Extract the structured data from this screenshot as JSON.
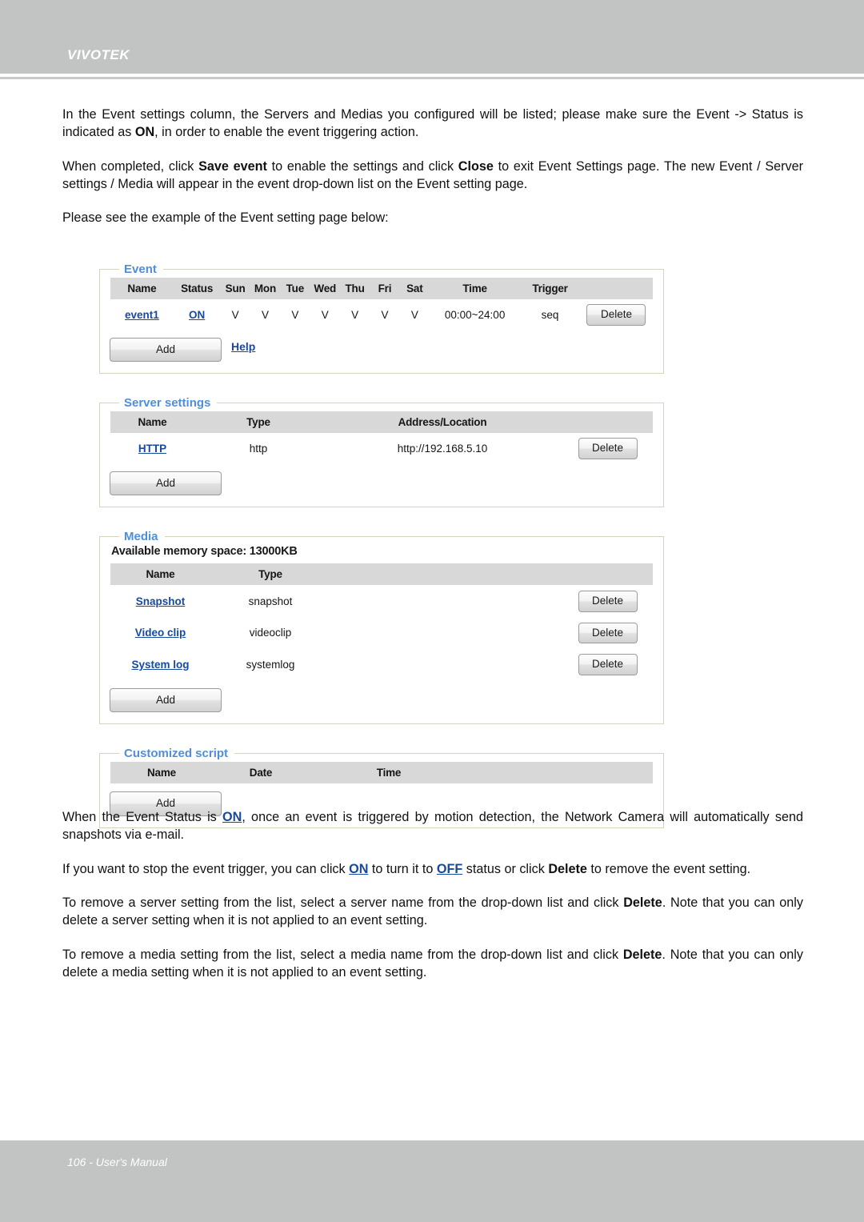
{
  "header": {
    "brand": "VIVOTEK"
  },
  "body_paragraphs": {
    "p1_a": "In the Event settings column, the Servers and Medias you configured will be listed; please make sure the Event -> Status is indicated as ",
    "p1_on": "ON",
    "p1_b": ", in order to enable the event triggering action.",
    "p2_a": "When completed, click ",
    "p2_save": "Save event",
    "p2_b": " to enable the settings and click ",
    "p2_close": "Close",
    "p2_c": " to exit Event Settings page. The new Event / Server settings / Media will appear in the event drop-down list on the Event setting page.",
    "p3": "Please see the example of the Event setting page below:",
    "p4_a": "When the Event Status is ",
    "p4_on": "ON",
    "p4_b": ", once an event is triggered by motion detection, the Network Camera will automatically send snapshots via e-mail.",
    "p5_a": "If you want to stop the event trigger, you can click ",
    "p5_on": "ON",
    "p5_b": " to turn it to ",
    "p5_off": "OFF",
    "p5_c": " status or click ",
    "p5_delete": "Delete",
    "p5_d": " to remove the event setting.",
    "p6_a": "To remove a server setting from the list, select a server name from the drop-down list and click ",
    "p6_delete": "Delete",
    "p6_b": ". Note that you can only delete a server setting when it is not applied to an event setting.",
    "p7_a": "To remove a media setting from the list, select a media name from the drop-down list and click ",
    "p7_delete": "Delete",
    "p7_b": ". Note that you can only delete a media setting when it is not applied to an event setting."
  },
  "event_panel": {
    "legend": "Event",
    "columns": [
      "Name",
      "Status",
      "Sun",
      "Mon",
      "Tue",
      "Wed",
      "Thu",
      "Fri",
      "Sat",
      "Time",
      "Trigger",
      ""
    ],
    "rows": [
      {
        "name": "event1",
        "status": "ON",
        "sun": "V",
        "mon": "V",
        "tue": "V",
        "wed": "V",
        "thu": "V",
        "fri": "V",
        "sat": "V",
        "time": "00:00~24:00",
        "trigger": "seq",
        "delete_label": "Delete"
      }
    ],
    "add_label": "Add",
    "help_label": "Help"
  },
  "server_panel": {
    "legend": "Server settings",
    "columns": [
      "Name",
      "Type",
      "Address/Location",
      ""
    ],
    "rows": [
      {
        "name": "HTTP",
        "type": "http",
        "address": "http://192.168.5.10",
        "delete_label": "Delete"
      }
    ],
    "add_label": "Add"
  },
  "media_panel": {
    "legend": "Media",
    "memory_line": "Available memory space: 13000KB",
    "columns": [
      "Name",
      "Type",
      "",
      ""
    ],
    "rows": [
      {
        "name": "Snapshot",
        "type": "snapshot",
        "delete_label": "Delete"
      },
      {
        "name": "Video clip",
        "type": "videoclip",
        "delete_label": "Delete"
      },
      {
        "name": "System log",
        "type": "systemlog",
        "delete_label": "Delete"
      }
    ],
    "add_label": "Add"
  },
  "script_panel": {
    "legend": "Customized script",
    "columns": [
      "Name",
      "Date",
      "Time",
      ""
    ],
    "rows": [],
    "add_label": "Add"
  },
  "footer": {
    "text": "106 - User's Manual"
  },
  "colors": {
    "header_bar": "#c2c4c4",
    "legend_blue": "#4f8fd8",
    "link_blue": "#17499e",
    "table_header_gray": "#d8d8d8",
    "panel_border": "#d8d2c2"
  }
}
